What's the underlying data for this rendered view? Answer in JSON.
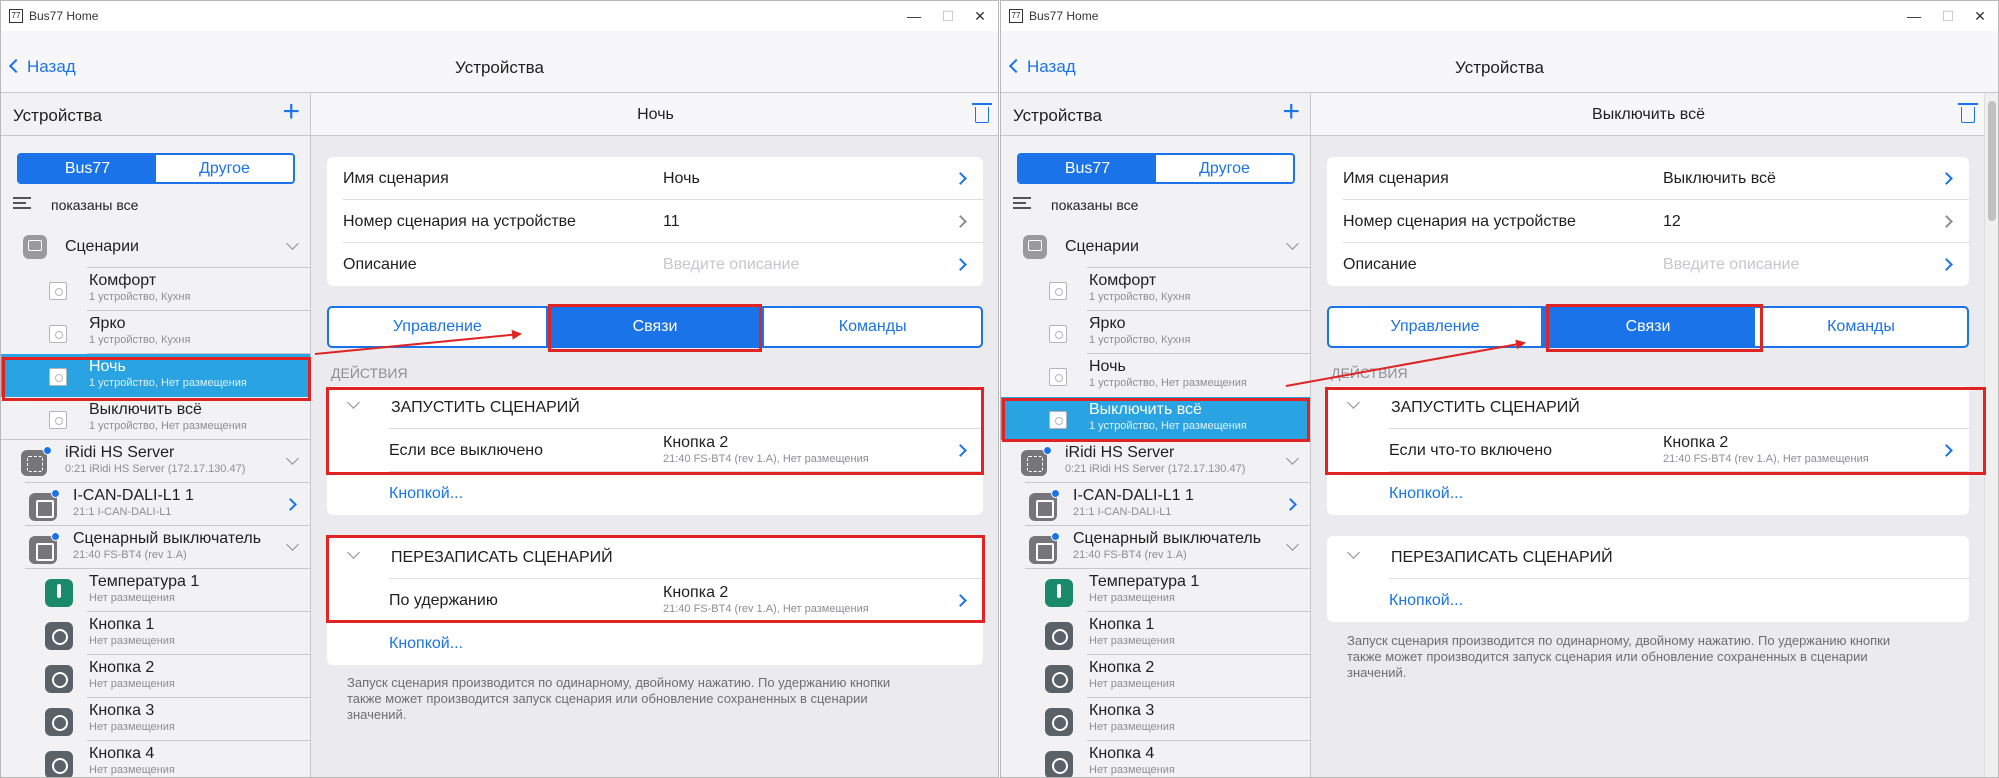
{
  "left": {
    "app_title": "Bus77 Home",
    "back": "Назад",
    "nav_title": "Устройства",
    "sidebar": {
      "title": "Устройства",
      "segments": [
        "Bus77",
        "Другое"
      ],
      "filter": "показаны все",
      "rows": [
        {
          "name": "Сценарии",
          "sub": ""
        },
        {
          "name": "Комфорт",
          "sub": "1 устройство, Кухня"
        },
        {
          "name": "Ярко",
          "sub": "1 устройство, Кухня"
        },
        {
          "name": "Ночь",
          "sub": "1 устройство, Нет размещения"
        },
        {
          "name": "Выключить всё",
          "sub": "1 устройство, Нет размещения"
        },
        {
          "name": "iRidi HS Server",
          "sub": "0:21 iRidi HS Server (172.17.130.47)"
        },
        {
          "name": "I-CAN-DALI-L1 1",
          "sub": "21:1 I-CAN-DALI-L1"
        },
        {
          "name": "Сценарный выключатель",
          "sub": "21:40 FS-BT4 (rev 1.A)"
        },
        {
          "name": "Температура 1",
          "sub": "Нет размещения"
        },
        {
          "name": "Кнопка 1",
          "sub": "Нет размещения"
        },
        {
          "name": "Кнопка 2",
          "sub": "Нет размещения"
        },
        {
          "name": "Кнопка 3",
          "sub": "Нет размещения"
        },
        {
          "name": "Кнопка 4",
          "sub": "Нет размещения"
        }
      ]
    },
    "main": {
      "title": "Ночь",
      "fields": [
        {
          "label": "Имя сценария",
          "value": "Ночь"
        },
        {
          "label": "Номер сценария на устройстве",
          "value": "11"
        },
        {
          "label": "Описание",
          "placeholder": "Введите описание"
        }
      ],
      "tabs": [
        "Управление",
        "Связи",
        "Команды"
      ],
      "section": "ДЕЙСТВИЯ",
      "group1": {
        "title": "ЗАПУСТИТЬ СЦЕНАРИЙ",
        "item": "Если все выключено",
        "target": "Кнопка 2",
        "target_sub": "21:40 FS-BT4 (rev 1.A), Нет размещения",
        "link": "Кнопкой..."
      },
      "group2": {
        "title": "ПЕРЕЗАПИСАТЬ СЦЕНАРИЙ",
        "item": "По удержанию",
        "target": "Кнопка 2",
        "target_sub": "21:40 FS-BT4 (rev 1.A), Нет размещения",
        "link": "Кнопкой..."
      },
      "note_lines": [
        "Запуск сценария производится по одинарному, двойному нажатию. По удержанию кнопки",
        " также может производится запуск сценария или обновление сохраненных в сценарии",
        "значений."
      ]
    }
  },
  "right": {
    "app_title": "Bus77 Home",
    "back": "Назад",
    "nav_title": "Устройства",
    "sidebar": {
      "title": "Устройства",
      "segments": [
        "Bus77",
        "Другое"
      ],
      "filter": "показаны все",
      "rows": [
        {
          "name": "Сценарии",
          "sub": ""
        },
        {
          "name": "Комфорт",
          "sub": "1 устройство, Кухня"
        },
        {
          "name": "Ярко",
          "sub": "1 устройство, Кухня"
        },
        {
          "name": "Ночь",
          "sub": "1 устройство, Нет размещения"
        },
        {
          "name": "Выключить всё",
          "sub": "1 устройство, Нет размещения"
        },
        {
          "name": "iRidi HS Server",
          "sub": "0:21 iRidi HS Server (172.17.130.47)"
        },
        {
          "name": "I-CAN-DALI-L1 1",
          "sub": "21:1 I-CAN-DALI-L1"
        },
        {
          "name": "Сценарный выключатель",
          "sub": "21:40 FS-BT4 (rev 1.A)"
        },
        {
          "name": "Температура 1",
          "sub": "Нет размещения"
        },
        {
          "name": "Кнопка 1",
          "sub": "Нет размещения"
        },
        {
          "name": "Кнопка 2",
          "sub": "Нет размещения"
        },
        {
          "name": "Кнопка 3",
          "sub": "Нет размещения"
        },
        {
          "name": "Кнопка 4",
          "sub": "Нет размещения"
        }
      ]
    },
    "main": {
      "title": "Выключить всё",
      "fields": [
        {
          "label": "Имя сценария",
          "value": "Выключить всё"
        },
        {
          "label": "Номер сценария на устройстве",
          "value": "12"
        },
        {
          "label": "Описание",
          "placeholder": "Введите описание"
        }
      ],
      "tabs": [
        "Управление",
        "Связи",
        "Команды"
      ],
      "section": "ДЕЙСТВИЯ",
      "group1": {
        "title": "ЗАПУСТИТЬ СЦЕНАРИЙ",
        "item": "Если что-то включено",
        "target": "Кнопка 2",
        "target_sub": "21:40 FS-BT4 (rev 1.A), Нет размещения",
        "link": "Кнопкой..."
      },
      "group2": {
        "title": "ПЕРЕЗАПИСАТЬ СЦЕНАРИЙ",
        "link": "Кнопкой..."
      },
      "note_lines": [
        "Запуск сценария производится по одинарному, двойному нажатию. По удержанию кнопки",
        " также может производится запуск сценария или обновление сохраненных в сценарии",
        "значений."
      ]
    }
  },
  "window_controls": {
    "minimize": "—",
    "maximize": "☐",
    "close": "✕"
  },
  "colors": {
    "accent": "#1a73e8",
    "selected_row": "#2aa3e2",
    "highlight": "#e02424"
  }
}
